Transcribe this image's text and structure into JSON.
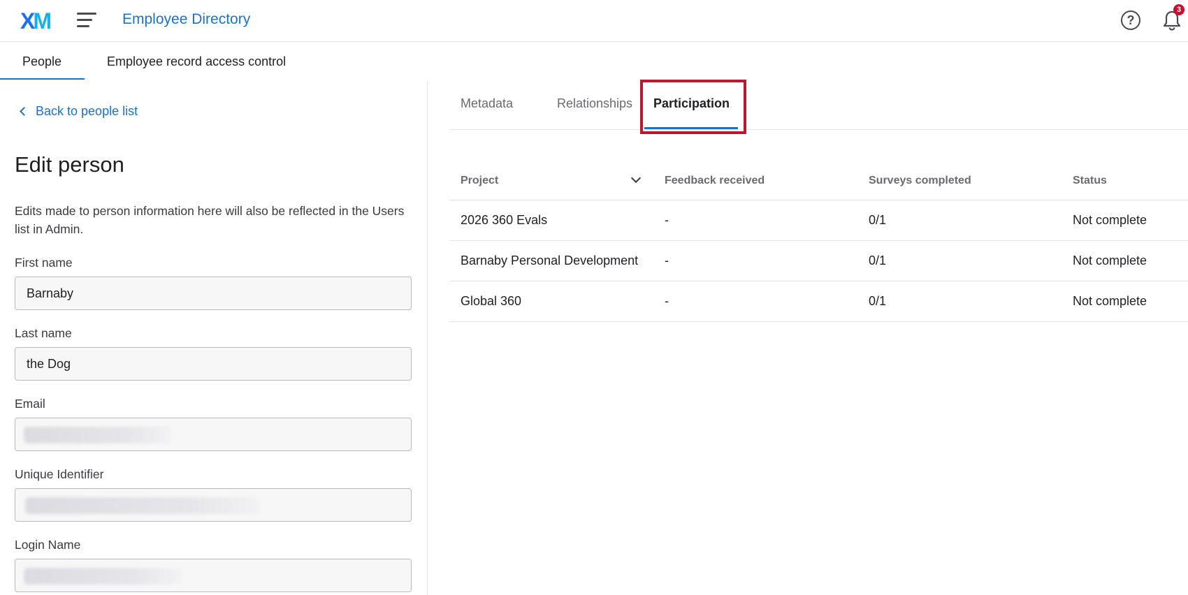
{
  "header": {
    "logo_text": "XM",
    "app_title": "Employee Directory",
    "notification_count": "3"
  },
  "subnav": {
    "tabs": [
      {
        "label": "People"
      },
      {
        "label": "Employee record access control"
      }
    ]
  },
  "left": {
    "back_link": "Back to people list",
    "title": "Edit person",
    "description": "Edits made to person information here will also be reflected in the Users list in Admin.",
    "fields": {
      "first_name": {
        "label": "First name",
        "value": "Barnaby"
      },
      "last_name": {
        "label": "Last name",
        "value": "the Dog"
      },
      "email": {
        "label": "Email"
      },
      "unique_identifier": {
        "label": "Unique Identifier"
      },
      "login_name": {
        "label": "Login Name"
      }
    }
  },
  "right": {
    "tabs": [
      {
        "label": "Metadata"
      },
      {
        "label": "Relationships"
      },
      {
        "label": "Participation"
      }
    ],
    "table": {
      "headers": [
        "Project",
        "Feedback received",
        "Surveys completed",
        "Status"
      ],
      "rows": [
        [
          "2026 360 Evals",
          "-",
          "0/1",
          "Not complete"
        ],
        [
          "Barnaby Personal Development",
          "-",
          "0/1",
          "Not complete"
        ],
        [
          "Global 360",
          "-",
          "0/1",
          "Not complete"
        ]
      ]
    }
  },
  "colors": {
    "accent": "#1a73c8",
    "highlight": "#c0152f",
    "badge": "#c8102e"
  }
}
